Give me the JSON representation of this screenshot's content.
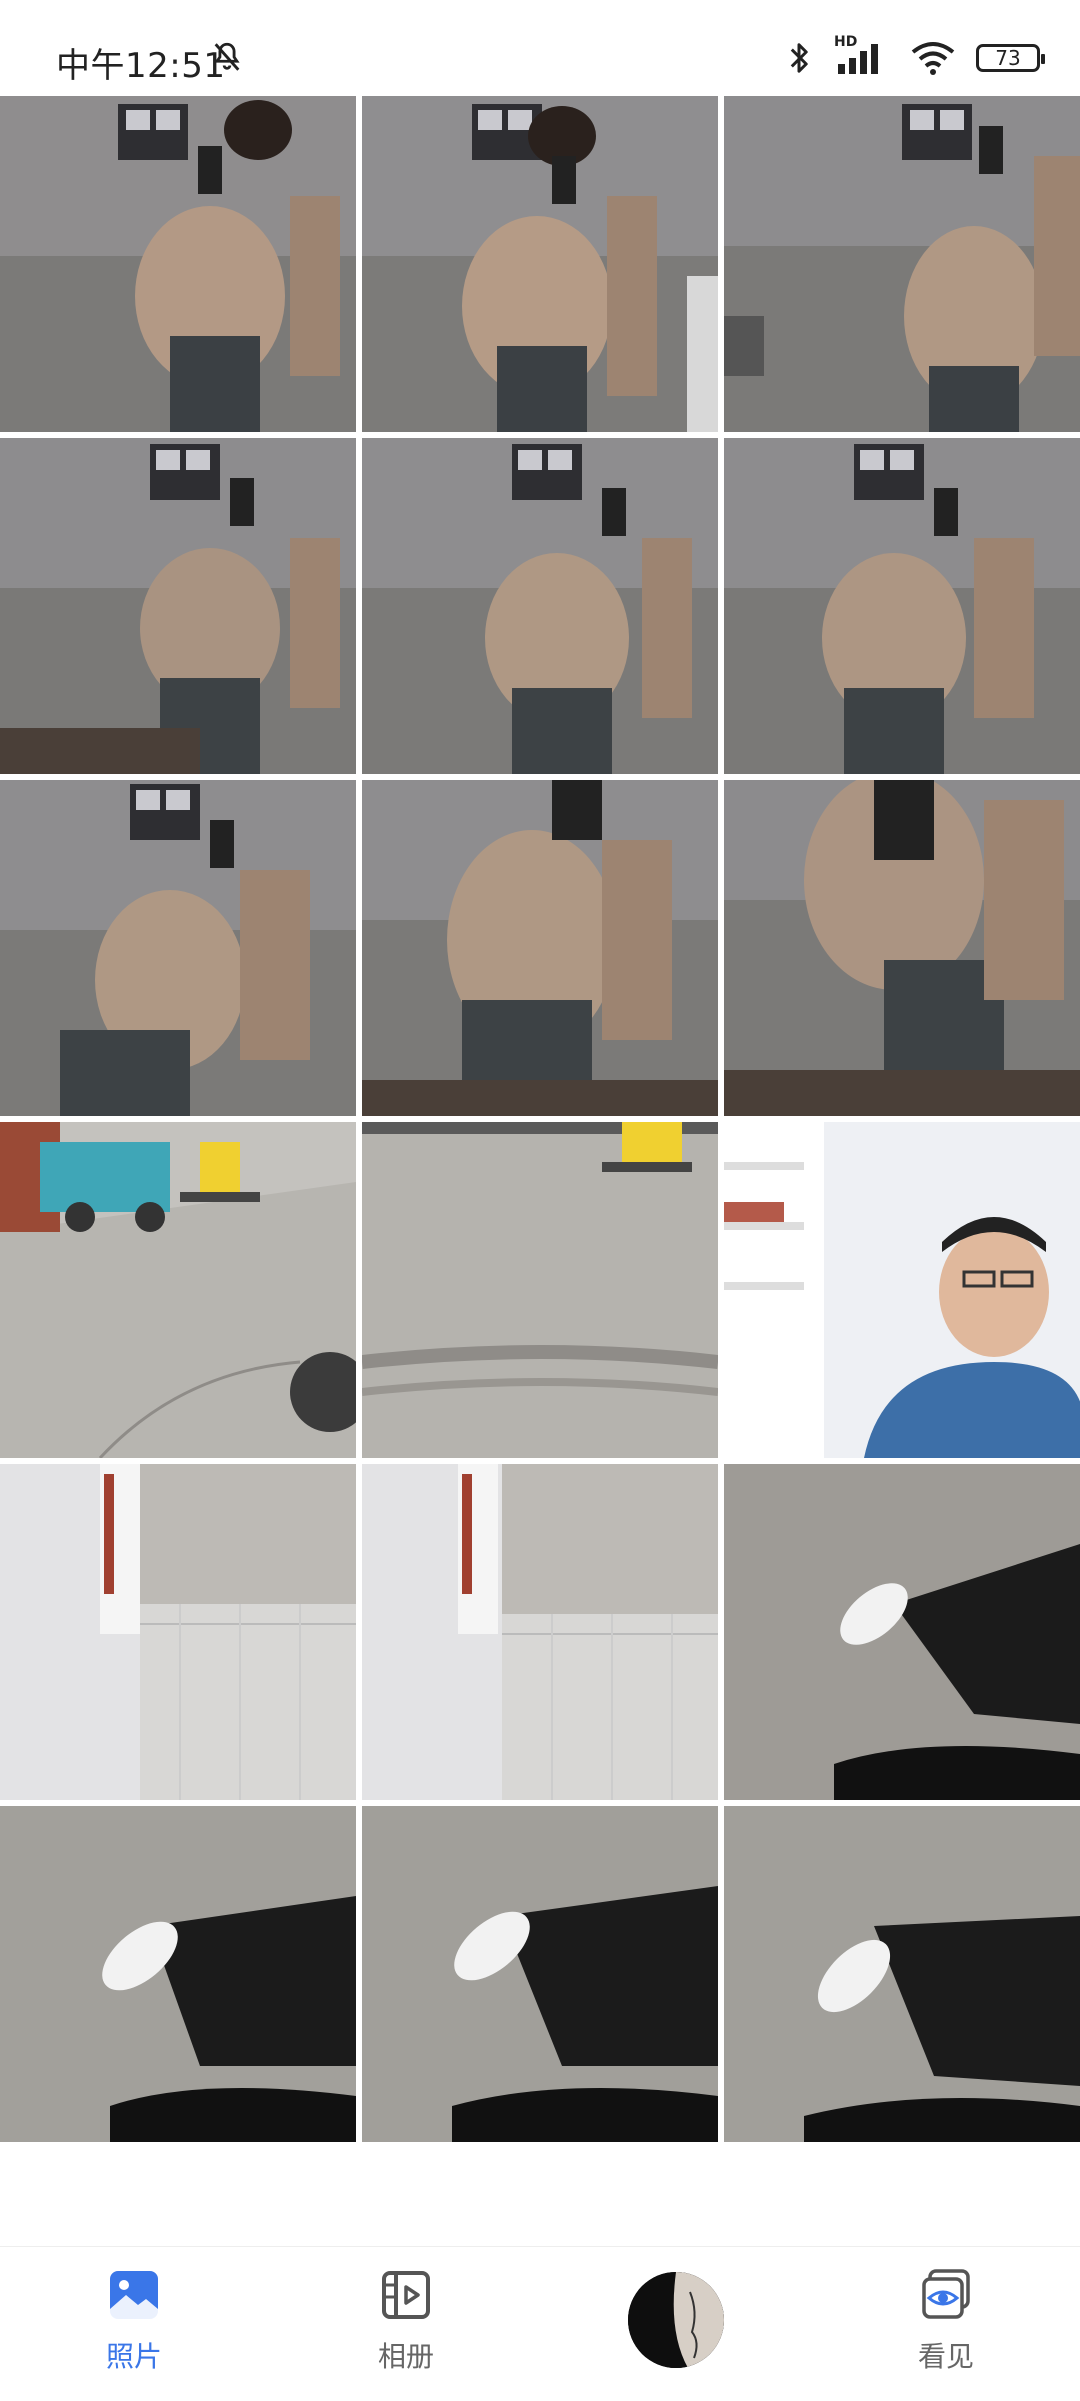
{
  "status_bar": {
    "time": "中午12:51",
    "battery_level": "73",
    "signal_label": "HD"
  },
  "photos": [
    {
      "kind": "mirror-selfie"
    },
    {
      "kind": "mirror-selfie"
    },
    {
      "kind": "mirror-selfie"
    },
    {
      "kind": "mirror-selfie"
    },
    {
      "kind": "mirror-selfie"
    },
    {
      "kind": "mirror-selfie"
    },
    {
      "kind": "mirror-selfie"
    },
    {
      "kind": "mirror-selfie"
    },
    {
      "kind": "mirror-selfie"
    },
    {
      "kind": "street"
    },
    {
      "kind": "street"
    },
    {
      "kind": "video-call"
    },
    {
      "kind": "ceiling"
    },
    {
      "kind": "ceiling"
    },
    {
      "kind": "feet-floor"
    },
    {
      "kind": "feet-floor"
    },
    {
      "kind": "feet-floor"
    },
    {
      "kind": "feet-floor"
    }
  ],
  "tabs": [
    {
      "label": "照片",
      "icon": "photo-icon",
      "active": true
    },
    {
      "label": "相册",
      "icon": "album-icon",
      "active": false
    },
    {
      "label": "看见",
      "icon": "see-icon",
      "active": false
    }
  ],
  "colors": {
    "accent": "#3a76e8",
    "inactive": "#666666"
  }
}
